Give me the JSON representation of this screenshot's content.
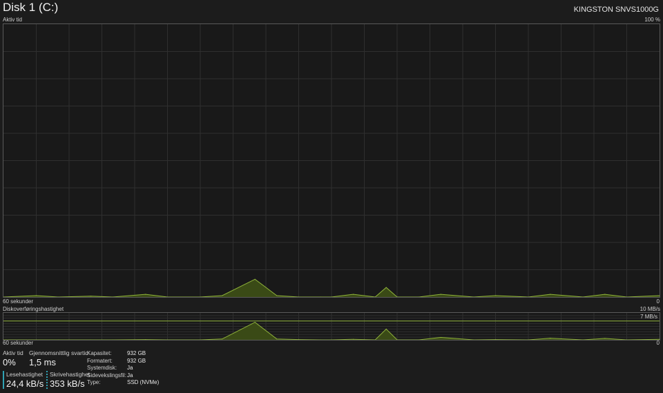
{
  "header": {
    "title": "Disk 1 (C:)",
    "model": "KINGSTON SNVS1000G"
  },
  "active_chart": {
    "label": "Aktiv tid",
    "max_label": "100 %",
    "time_label": "60 sekunder",
    "min_label": "0"
  },
  "transfer_chart": {
    "label": "Diskoverføringshastighet",
    "max_label": "10 MB/s",
    "ref_label": "7 MB/s",
    "time_label": "60 sekunder",
    "min_label": "0"
  },
  "stats": {
    "active_time_label": "Aktiv tid",
    "active_time_value": "0%",
    "avg_response_label": "Gjennomsnittlig svartid",
    "avg_response_value": "1,5 ms",
    "read_label": "Lesehastighet",
    "read_value": "24,4 kB/s",
    "write_label": "Skrivehastighet",
    "write_value": "353 kB/s"
  },
  "properties": [
    {
      "label": "Kapasitet:",
      "value": "932 GB"
    },
    {
      "label": "Formatert:",
      "value": "932 GB"
    },
    {
      "label": "Systemdisk:",
      "value": "Ja"
    },
    {
      "label": "Sidevekslingsfil:",
      "value": "Ja"
    },
    {
      "label": "Type:",
      "value": "SSD (NVMe)"
    }
  ],
  "colors": {
    "line": "#8fb33a",
    "fill": "#3a4a16",
    "grid": "#2f2f2f",
    "border": "#5a5a5a",
    "accent": "#2fa3b5"
  },
  "chart_data": [
    {
      "type": "area",
      "title": "Aktiv tid",
      "ylabel": "",
      "ylim": [
        0,
        100
      ],
      "x_unit": "seconds ago",
      "x": [
        60,
        57,
        55,
        52,
        50,
        47,
        45,
        42,
        40,
        37,
        35,
        33,
        31,
        30,
        28,
        26,
        25,
        24,
        22,
        20,
        17,
        15,
        12,
        10,
        7,
        5,
        3,
        0
      ],
      "values": [
        0,
        0.5,
        0,
        0.3,
        0,
        1,
        0,
        0,
        0.5,
        6.5,
        0.5,
        0,
        0,
        0,
        1,
        0,
        3.5,
        0,
        0,
        1,
        0,
        0.5,
        0,
        1,
        0,
        1,
        0,
        0.5
      ]
    },
    {
      "type": "area",
      "title": "Diskoverføringshastighet",
      "ylabel": "",
      "ylim": [
        0,
        10
      ],
      "x_unit": "seconds ago",
      "x": [
        60,
        57,
        55,
        52,
        50,
        47,
        45,
        42,
        40,
        37,
        35,
        33,
        31,
        30,
        28,
        26,
        25,
        24,
        22,
        20,
        17,
        15,
        12,
        10,
        7,
        5,
        3,
        0
      ],
      "values": [
        0,
        0,
        0,
        0,
        0,
        0.1,
        0,
        0,
        0.3,
        6.5,
        0.3,
        0.1,
        0,
        0,
        0.2,
        0,
        4.0,
        0,
        0,
        0.9,
        0,
        0.1,
        0,
        0.6,
        0,
        0.5,
        0,
        0.2
      ],
      "reference_line": 7
    }
  ]
}
